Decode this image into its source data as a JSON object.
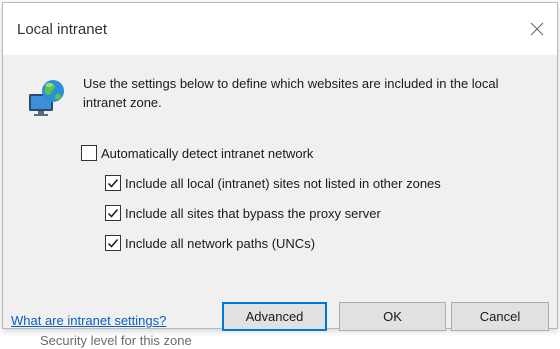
{
  "background": {
    "behind_text": "Security level for this zone"
  },
  "dialog": {
    "title": "Local intranet",
    "close_icon": "close-icon",
    "zone_icon": "intranet-globe-icon",
    "intro_text": "Use the settings below to define which websites are included in the local intranet zone.",
    "options": {
      "auto_detect": {
        "label": "Automatically detect intranet network",
        "checked": false
      },
      "include_local": {
        "label": "Include all local (intranet) sites not listed in other zones",
        "checked": true
      },
      "include_bypass": {
        "label": "Include all sites that bypass the proxy server",
        "checked": true
      },
      "include_unc": {
        "label": "Include all network paths (UNCs)",
        "checked": true
      }
    },
    "help_link": "What are intranet settings?",
    "buttons": {
      "advanced": "Advanced",
      "ok": "OK",
      "cancel": "Cancel"
    }
  },
  "colors": {
    "accent": "#0078d7",
    "link": "#0b5fc0",
    "dialog_bg": "#f0f0f0",
    "titlebar_bg": "#ffffff"
  }
}
